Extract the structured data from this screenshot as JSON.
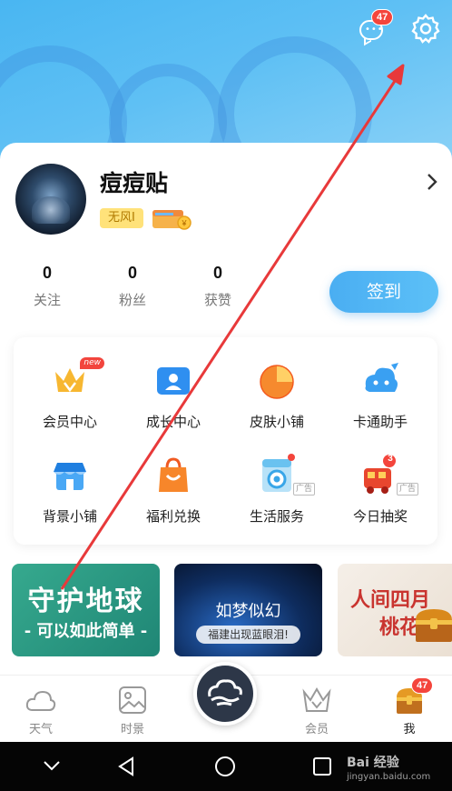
{
  "header": {
    "message_badge": "47"
  },
  "profile": {
    "username": "痘痘贴",
    "level_tag": "无风I"
  },
  "stats": [
    {
      "value": "0",
      "label": "关注"
    },
    {
      "value": "0",
      "label": "粉丝"
    },
    {
      "value": "0",
      "label": "获赞"
    }
  ],
  "checkin_label": "签到",
  "grid": {
    "row1": [
      {
        "label": "会员中心",
        "icon": "crown-icon",
        "tag": "new"
      },
      {
        "label": "成长中心",
        "icon": "growth-card-icon"
      },
      {
        "label": "皮肤小铺",
        "icon": "skin-shop-icon"
      },
      {
        "label": "卡通助手",
        "icon": "cartoon-assistant-icon"
      }
    ],
    "row2": [
      {
        "label": "背景小铺",
        "icon": "background-shop-icon"
      },
      {
        "label": "福利兑换",
        "icon": "gift-bag-icon"
      },
      {
        "label": "生活服务",
        "icon": "washing-machine-icon",
        "ad": "广告"
      },
      {
        "label": "今日抽奖",
        "icon": "lottery-train-icon",
        "ad": "广告",
        "count": "3"
      }
    ]
  },
  "banners": [
    {
      "line1": "守护地球",
      "line2": "- 可以如此简单 -"
    },
    {
      "line1": "如梦似幻",
      "line2": "福建出现蓝眼泪!"
    },
    {
      "line1": "人间四月",
      "line2": "桃花"
    }
  ],
  "tabbar": {
    "tabs": [
      {
        "label": "天气",
        "icon": "cloud-icon"
      },
      {
        "label": "时景",
        "icon": "photo-icon"
      },
      {
        "label": "会员",
        "icon": "crown-outline-icon"
      },
      {
        "label": "我",
        "icon": "treasure-chest-icon",
        "badge": "47"
      }
    ]
  },
  "watermark": {
    "text": "Bai 经验",
    "sub": "jingyan.baidu.com"
  },
  "colors": {
    "accent": "#4aaef2",
    "badge": "#f4453c",
    "annotation_arrow": "#e8393a"
  }
}
